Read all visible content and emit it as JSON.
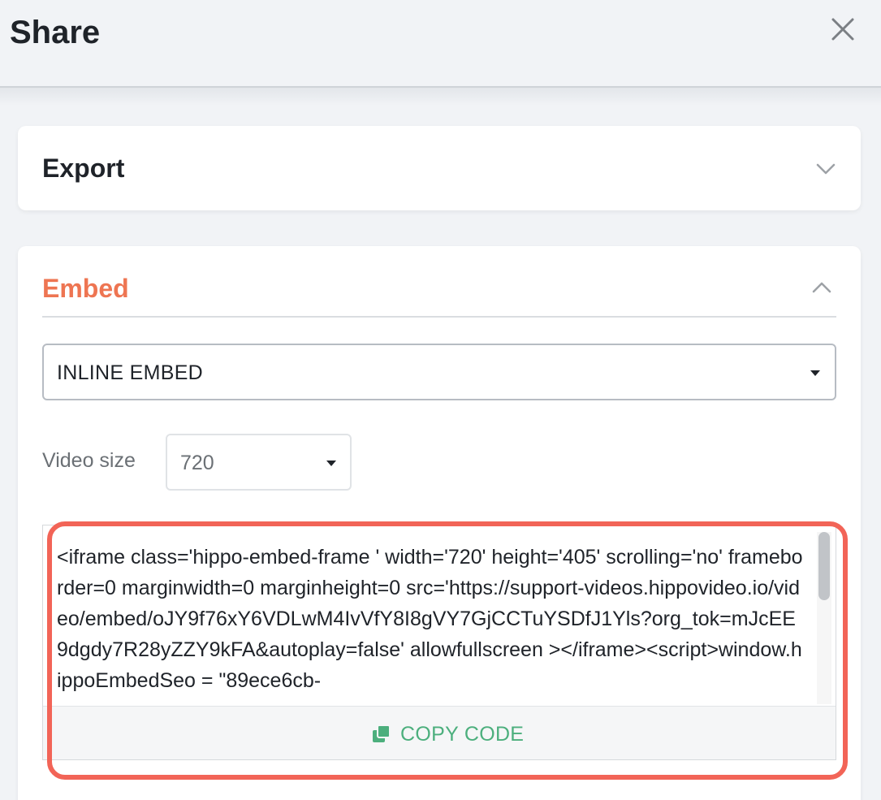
{
  "header": {
    "title": "Share",
    "close_icon": "close-icon"
  },
  "export": {
    "title": "Export",
    "icon": "chevron-down-icon"
  },
  "embed": {
    "title": "Embed",
    "accent_color": "#ee7552",
    "icon": "chevron-up-icon",
    "embed_type": {
      "selected": "INLINE EMBED"
    },
    "video_size": {
      "label": "Video size",
      "selected": "720"
    },
    "code": "<iframe class='hippo-embed-frame ' width='720' height='405' scrolling='no' frameborder=0 marginwidth=0 marginheight=0 src='https://support-videos.hippovideo.io/video/embed/oJY9f76xY6VDLwM4IvVfY8I8gVY7GjCCTuYSDfJ1Yls?org_tok=mJcEE9dgdy7R28yZZY9kFA&autoplay=false' allowfullscreen ></iframe><script>window.hippoEmbedSeo = \"89ece6cb-",
    "copy_label": "COPY CODE",
    "copy_icon": "copy-icon",
    "copy_color": "#4caf7d"
  },
  "highlight_color": "#f26457"
}
